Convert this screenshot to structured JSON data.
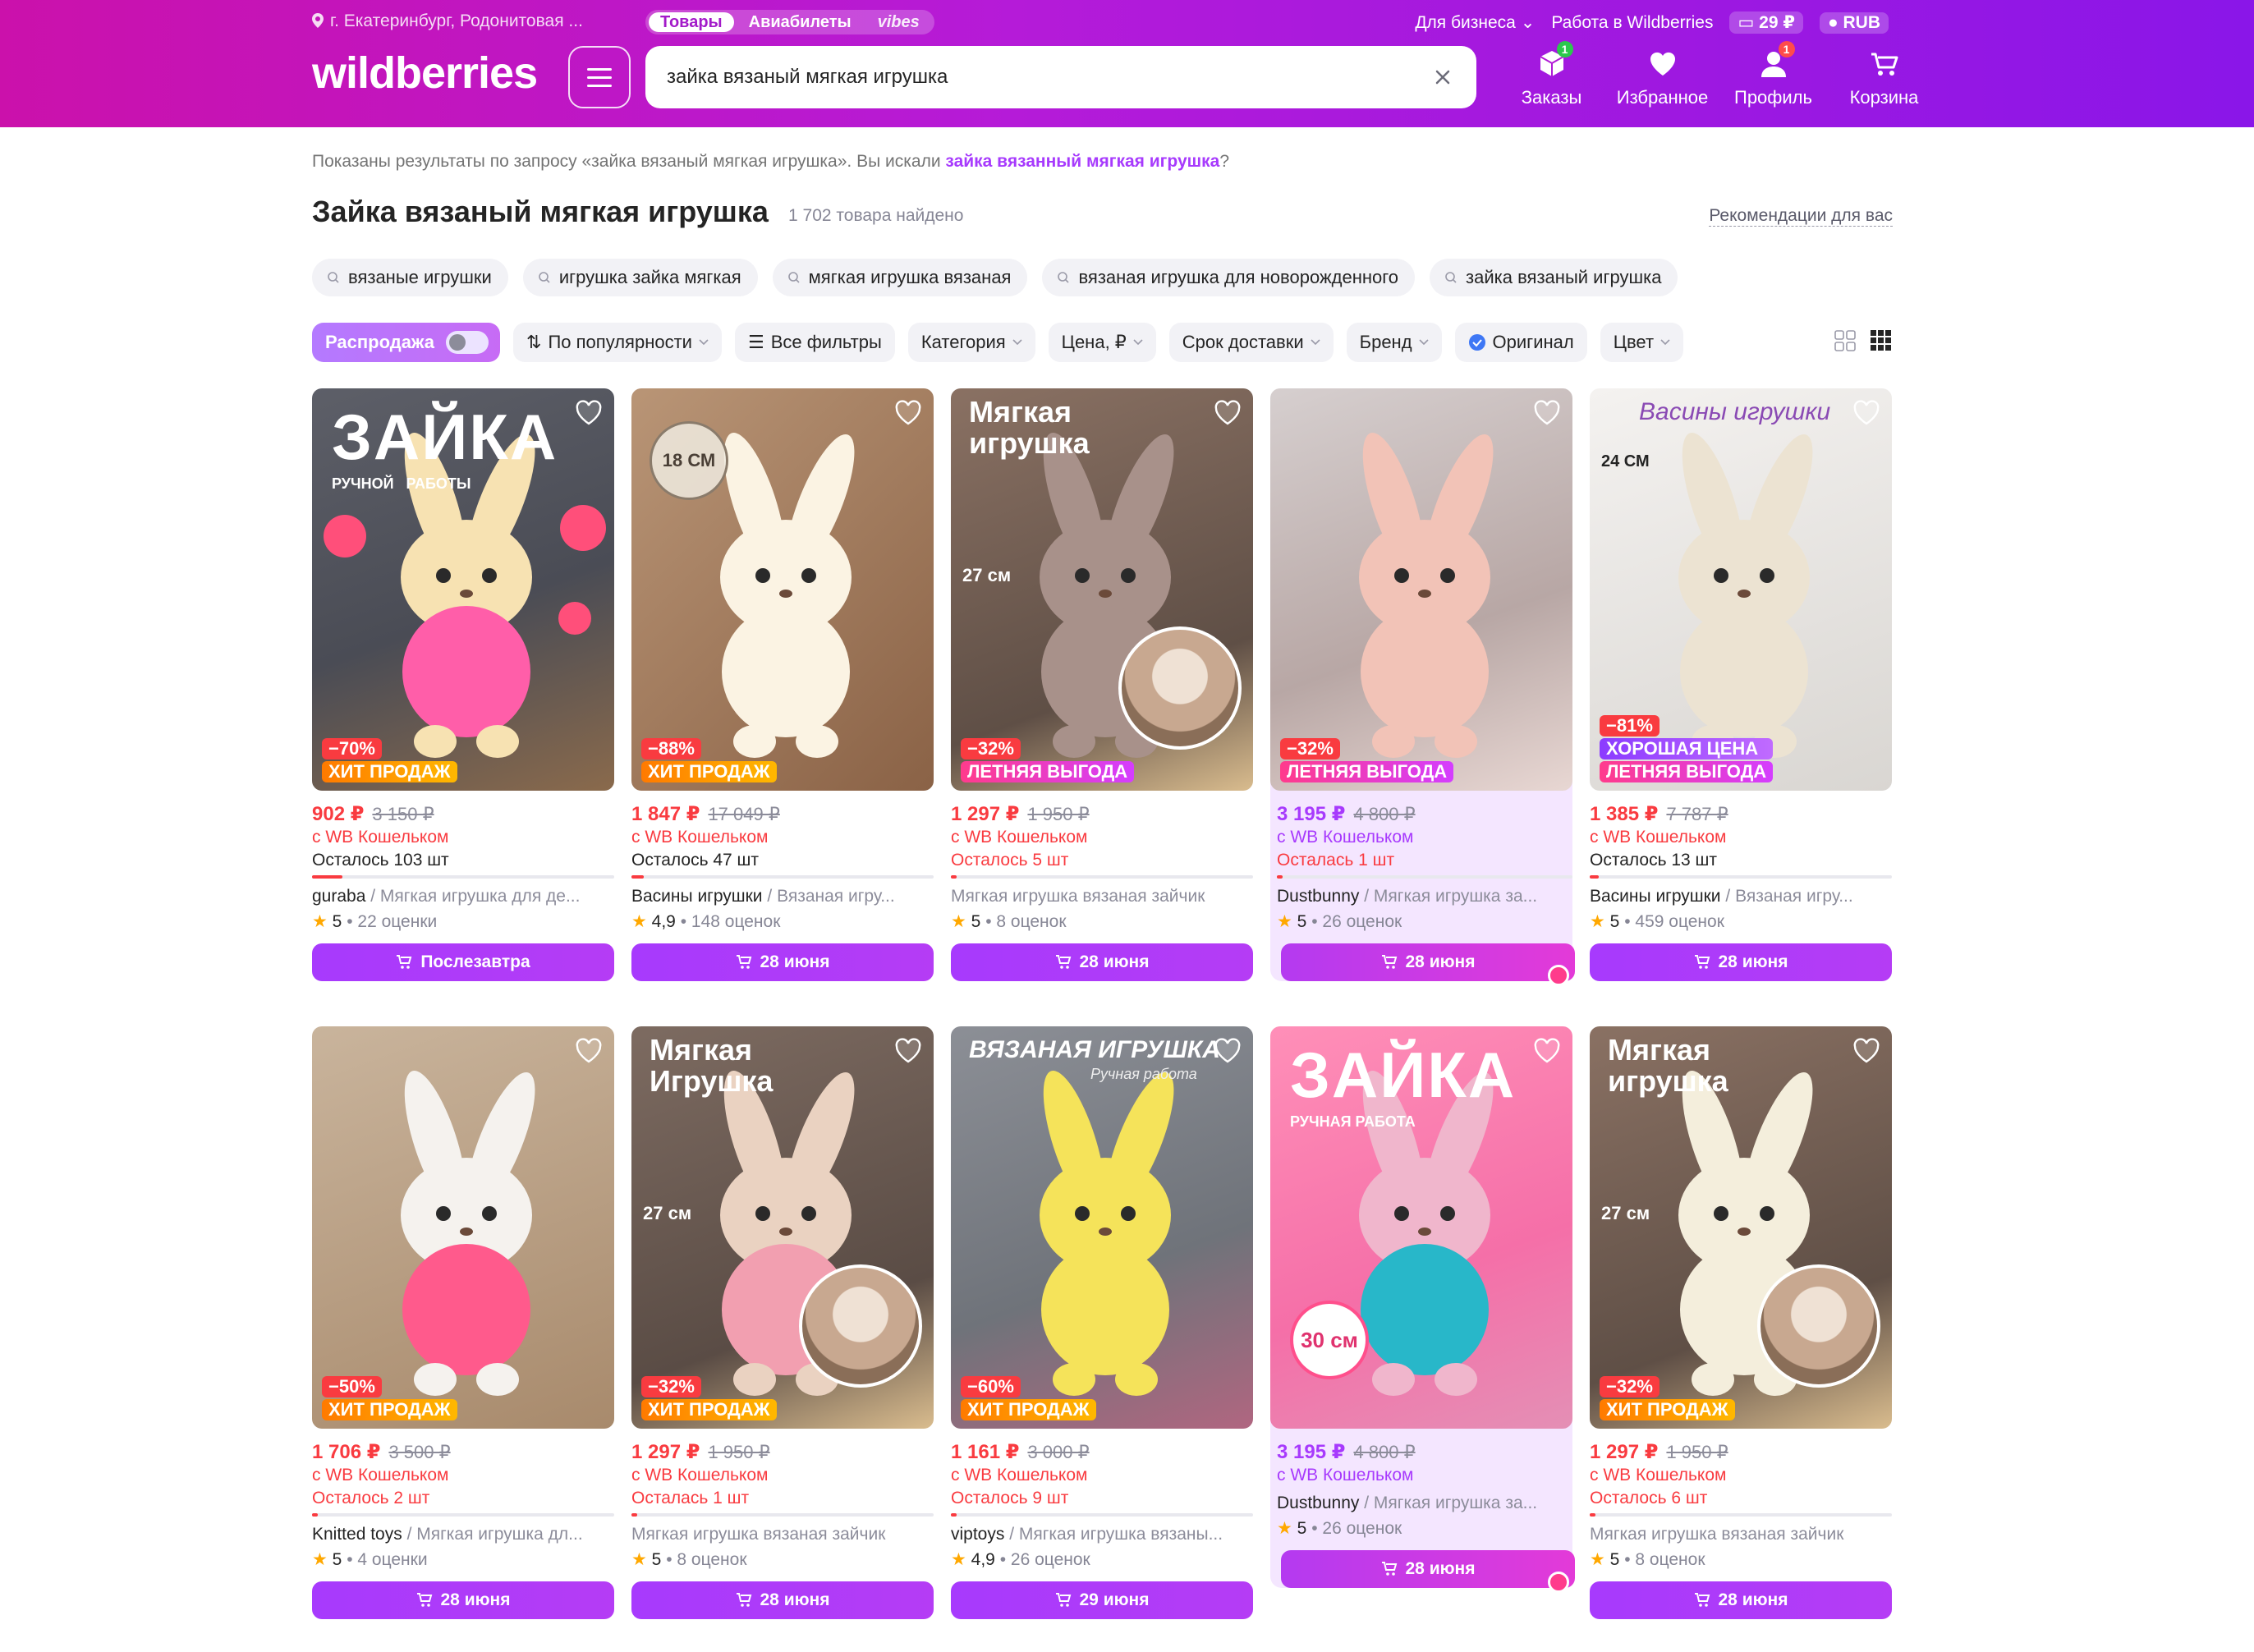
{
  "header": {
    "location": "г. Екатеринбург, Родонитовая ...",
    "tabs": [
      "Товары",
      "Авиабилеты",
      "vibes"
    ],
    "for_business": "Для бизнеса",
    "work": "Работа в Wildberries",
    "balance": "29 ₽",
    "currency": "RUB",
    "logo": "wildberries",
    "search_value": "зайка вязаный мягкая игрушка",
    "actions": [
      {
        "label": "Заказы",
        "badge": "1",
        "icon": "box-icon"
      },
      {
        "label": "Избранное",
        "badge": "",
        "icon": "heart-icon"
      },
      {
        "label": "Профиль",
        "badge": "1",
        "icon": "user-icon"
      },
      {
        "label": "Корзина",
        "badge": "",
        "icon": "cart-icon"
      }
    ]
  },
  "results": {
    "note_prefix": "Показаны результаты по запросу «зайка вязаный мягкая игрушка». Вы искали ",
    "note_query": "зайка вязанный мягкая игрушка",
    "note_suffix": "?",
    "title": "Зайка вязаный мягкая игрушка",
    "found": "1 702 товара найдено",
    "recommendations": "Рекомендации для вас"
  },
  "suggestions": [
    "вязаные игрушки",
    "игрушка зайка мягкая",
    "мягкая игрушка вязаная",
    "вязаная игрушка для новорожденного",
    "зайка вязаный игрушка"
  ],
  "filters": {
    "sale": "Распродажа",
    "sort": "По популярности",
    "all": "Все фильтры",
    "items": [
      "Категория",
      "Цена, ₽",
      "Срок доставки",
      "Бренд"
    ],
    "original": "Оригинал",
    "color": "Цвет"
  },
  "products": [
    {
      "price": "902 ₽",
      "old": "3 150 ₽",
      "wallet": "с WB Кошельком",
      "left": "Осталось 103 шт",
      "brand": "guraba",
      "name": "Мягкая игрушка для де...",
      "rating": "5",
      "reviews": "22 оценки",
      "button": "Послезавтра",
      "discount": "−70%",
      "tag": "ХИТ ПРОДАЖ",
      "tag2": "",
      "overlay": "ЗАЙКА",
      "overlay_sub": "РУЧНОЙ   РАБОТЫ",
      "size": "",
      "stock": 0.1
    },
    {
      "price": "1 847 ₽",
      "old": "17 049 ₽",
      "wallet": "с WB Кошельком",
      "left": "Осталось 47 шт",
      "brand": "Васины игрушки",
      "name": "Вязаная игру...",
      "rating": "4,9",
      "reviews": "148 оценок",
      "button": "28 июня",
      "discount": "−88%",
      "tag": "ХИТ ПРОДАЖ",
      "tag2": "",
      "overlay": "",
      "overlay_sub": "",
      "size": "18 СМ",
      "stock": 0.04
    },
    {
      "price": "1 297 ₽",
      "old": "1 950 ₽",
      "wallet": "с WB Кошельком",
      "left": "Осталось 5 шт",
      "brand": "",
      "name": "Мягкая игрушка вязаная зайчик",
      "rating": "5",
      "reviews": "8 оценок",
      "button": "28 июня",
      "discount": "−32%",
      "tag": "ЛЕТНЯЯ ВЫГОДА",
      "tag2": "",
      "overlay": "Мягкая\nигрушка",
      "overlay_sub": "",
      "size": "27 см",
      "stock": 0.02
    },
    {
      "price": "3 195 ₽",
      "old": "4 800 ₽",
      "wallet": "с WB Кошельком",
      "left": "Осталась 1 шт",
      "brand": "Dustbunny",
      "name": "Мягкая игрушка за...",
      "rating": "5",
      "reviews": "26 оценок",
      "button": "28 июня",
      "discount": "−32%",
      "tag": "ЛЕТНЯЯ ВЫГОДА",
      "tag2": "",
      "overlay": "",
      "overlay_sub": "",
      "size": "",
      "stock": 0.01
    },
    {
      "price": "1 385 ₽",
      "old": "7 787 ₽",
      "wallet": "с WB Кошельком",
      "left": "Осталось 13 шт",
      "brand": "Васины игрушки",
      "name": "Вязаная игру...",
      "rating": "5",
      "reviews": "459 оценок",
      "button": "28 июня",
      "discount": "−81%",
      "tag": "ХОРОШАЯ ЦЕНА",
      "tag2": "ЛЕТНЯЯ ВЫГОДА",
      "overlay": "Васины игрушки",
      "overlay_sub": "24 СМ",
      "size": "",
      "stock": 0.03
    },
    {
      "price": "1 706 ₽",
      "old": "3 500 ₽",
      "wallet": "с WB Кошельком",
      "left": "Осталось 2 шт",
      "brand": "Knitted toys",
      "name": "Мягкая игрушка дл...",
      "rating": "5",
      "reviews": "4 оценки",
      "button": "28 июня",
      "discount": "−50%",
      "tag": "ХИТ ПРОДАЖ",
      "tag2": "",
      "overlay": "",
      "overlay_sub": "",
      "size": "",
      "stock": 0.01
    },
    {
      "price": "1 297 ₽",
      "old": "1 950 ₽",
      "wallet": "с WB Кошельком",
      "left": "Осталась 1 шт",
      "brand": "",
      "name": "Мягкая игрушка вязаная зайчик",
      "rating": "5",
      "reviews": "8 оценок",
      "button": "28 июня",
      "discount": "−32%",
      "tag": "ХИТ ПРОДАЖ",
      "tag2": "",
      "overlay": "Мягкая\nИгрушка",
      "overlay_sub": "",
      "size": "27 см",
      "stock": 0.01
    },
    {
      "price": "1 161 ₽",
      "old": "3 000 ₽",
      "wallet": "с WB Кошельком",
      "left": "Осталось 9 шт",
      "brand": "viptoys",
      "name": "Мягкая игрушка вязаны...",
      "rating": "4,9",
      "reviews": "26 оценок",
      "button": "29 июня",
      "discount": "−60%",
      "tag": "ХИТ ПРОДАЖ",
      "tag2": "",
      "overlay": "ВЯЗАНАЯ ИГРУШКА",
      "overlay_sub": "Ручная работа",
      "size": "",
      "stock": 0.02
    },
    {
      "price": "3 195 ₽",
      "old": "4 800 ₽",
      "wallet": "с WB Кошельком",
      "left": "",
      "brand": "Dustbunny",
      "name": "Мягкая игрушка за...",
      "rating": "5",
      "reviews": "26 оценок",
      "button": "28 июня",
      "discount": "",
      "tag": "",
      "tag2": "",
      "overlay": "ЗАЙКА",
      "overlay_sub": "РУЧНАЯ РАБОТА",
      "size": "30 см",
      "stock": 0
    },
    {
      "price": "1 297 ₽",
      "old": "1 950 ₽",
      "wallet": "с WB Кошельком",
      "left": "Осталось 6 шт",
      "brand": "",
      "name": "Мягкая игрушка вязаная зайчик",
      "rating": "5",
      "reviews": "8 оценок",
      "button": "28 июня",
      "discount": "−32%",
      "tag": "ХИТ ПРОДАЖ",
      "tag2": "",
      "overlay": "Мягкая\nигрушка",
      "overlay_sub": "",
      "size": "27 см",
      "stock": 0.02
    }
  ],
  "colors": {
    "accent": "#a73afd",
    "sale_red": "#f93b40",
    "header_start": "#cb11ab",
    "header_end": "#8a16e8"
  }
}
